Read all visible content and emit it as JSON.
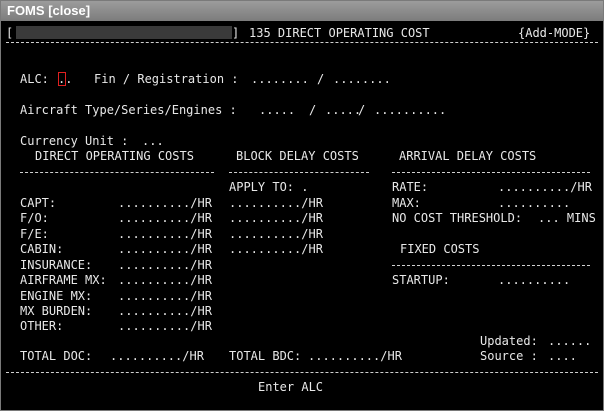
{
  "window": {
    "title": "FOMS",
    "close_label": "[close]"
  },
  "header": {
    "bracket_open": "[",
    "bracket_close": "]",
    "screen_title": "135 DIRECT OPERATING COST",
    "mode": "{Add-MODE}"
  },
  "form": {
    "alc_label": "ALC:",
    "alc_value": "..",
    "fin_label": "Fin / Registration :",
    "fin_value": "........",
    "slash1": "/",
    "reg_value": "........",
    "aircraft_label": "Aircraft Type/Series/Engines :",
    "type_value": ".....",
    "slash2": "/",
    "series_value": ".....",
    "slash3": "/",
    "engines_value": "..........",
    "currency_label": "Currency Unit :",
    "currency_value": "..."
  },
  "doc": {
    "header": "DIRECT OPERATING COSTS",
    "rows": [
      {
        "label": "CAPT:",
        "value": "........../HR"
      },
      {
        "label": "F/O:",
        "value": "........../HR"
      },
      {
        "label": "F/E:",
        "value": "........../HR"
      },
      {
        "label": "CABIN:",
        "value": "........../HR"
      },
      {
        "label": "INSURANCE:",
        "value": "........../HR"
      },
      {
        "label": "AIRFRAME MX:",
        "value": "........../HR"
      },
      {
        "label": "ENGINE MX:",
        "value": "........../HR"
      },
      {
        "label": "MX BURDEN:",
        "value": "........../HR"
      },
      {
        "label": "OTHER:",
        "value": "........../HR"
      }
    ],
    "total_label": "TOTAL DOC:",
    "total_value": "........../HR"
  },
  "bdc": {
    "header": "BLOCK DELAY COSTS",
    "apply_label": "APPLY TO: .",
    "rows": [
      "........../HR",
      "........../HR",
      "........../HR",
      "........../HR"
    ],
    "total_label": "TOTAL BDC:",
    "total_value": "........../HR"
  },
  "adc": {
    "header": "ARRIVAL DELAY COSTS",
    "rate_label": "RATE:",
    "rate_value": "........../HR",
    "max_label": "MAX:",
    "max_value": "..........",
    "threshold_label": "NO COST THRESHOLD:",
    "threshold_value": "... MINS"
  },
  "fixed": {
    "header": "FIXED COSTS",
    "startup_label": "STARTUP:",
    "startup_value": ".........."
  },
  "footer": {
    "updated_label": "Updated:",
    "updated_value": "......",
    "source_label": "Source :",
    "source_value": "....",
    "message": "Enter ALC"
  }
}
